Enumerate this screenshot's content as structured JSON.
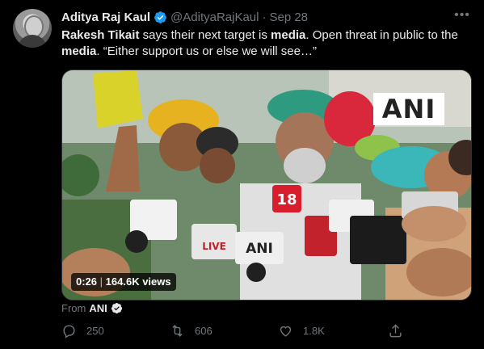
{
  "author": {
    "name": "Aditya Raj Kaul",
    "handle": "@AdityaRajKaul",
    "separator": "·",
    "date": "Sep 28"
  },
  "tweet": {
    "segments": [
      {
        "text": "Rakesh Tikait",
        "bold": true
      },
      {
        "text": " says their next target is ",
        "bold": false
      },
      {
        "text": "media",
        "bold": true
      },
      {
        "text": ". Open threat in public to the ",
        "bold": false
      },
      {
        "text": "media",
        "bold": true
      },
      {
        "text": ". “Either support us or else we will see…”",
        "bold": false
      }
    ]
  },
  "media": {
    "watermark": "ANI",
    "duration": "0:26",
    "views": "164.6K views",
    "mic_labels": [
      "18",
      "ANI",
      "LIVE"
    ]
  },
  "source": {
    "prefix": "From",
    "name": "ANI"
  },
  "actions": {
    "reply_count": "250",
    "retweet_count": "606",
    "like_count": "1.8K"
  },
  "colors": {
    "background": "#000000",
    "verified": "#1d9bf0",
    "muted": "#71767b"
  }
}
